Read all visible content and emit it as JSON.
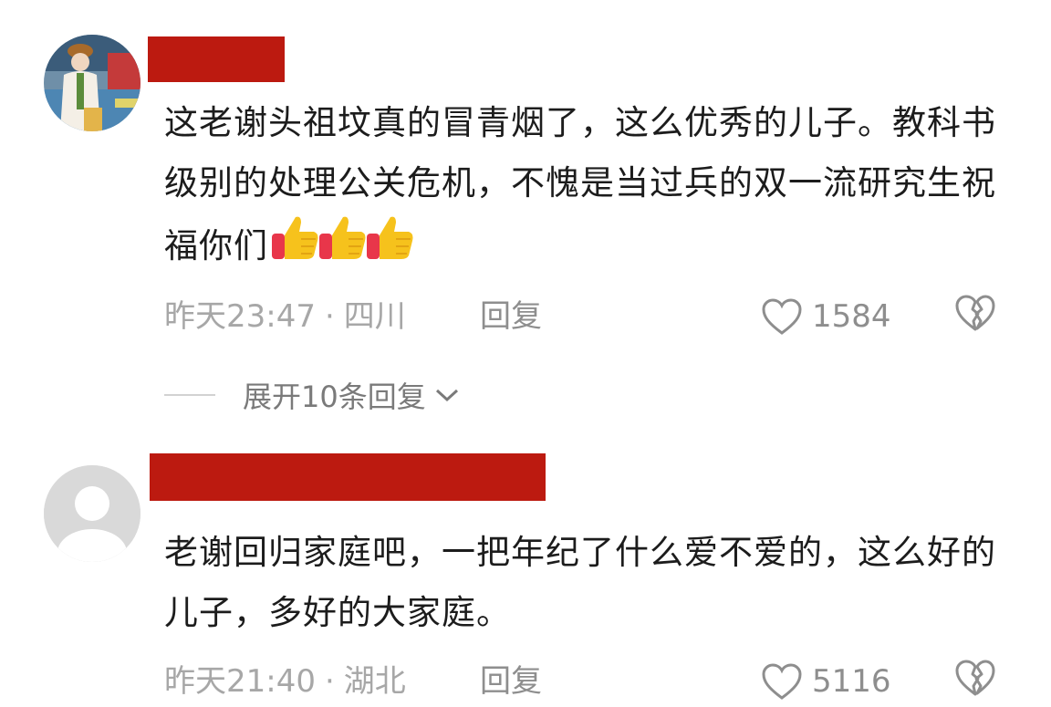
{
  "comments": [
    {
      "text": "这老谢头祖坟真的冒青烟了，这么优秀的儿子。教科书级别的处理公关危机，不愧是当过兵的双一流研究生祝福你们",
      "emoji": "thumbs-up-icon x3",
      "time": "昨天23:47",
      "location": "四川",
      "reply_label": "回复",
      "likes": "1584",
      "expand_label": "展开10条回复"
    },
    {
      "text": "老谢回归家庭吧，一把年纪了什么爱不爱的，这么好的儿子，多好的大家庭。",
      "time": "昨天21:40",
      "location": "湖北",
      "reply_label": "回复",
      "likes": "5116"
    }
  ],
  "separator": "·",
  "colors": {
    "redaction": "#bc1a10",
    "meta_text": "#a7a7a7"
  }
}
